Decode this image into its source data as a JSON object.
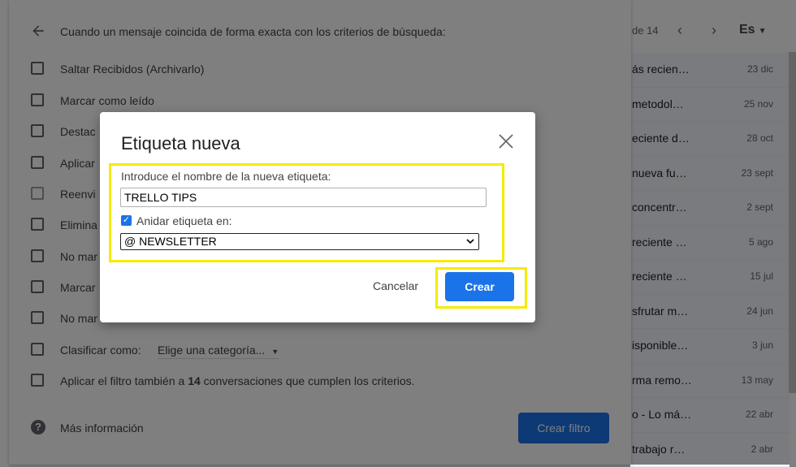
{
  "mail_list": {
    "range_text": "de 14",
    "lang_label": "Es",
    "rows": [
      {
        "snippet": "ás recien…",
        "date": "23 dic"
      },
      {
        "snippet": "metodol…",
        "date": "25 nov"
      },
      {
        "snippet": "eciente d…",
        "date": "28 oct"
      },
      {
        "snippet": "nueva fu…",
        "date": "23 sept"
      },
      {
        "snippet": "concentr…",
        "date": "2 sept"
      },
      {
        "snippet": "reciente …",
        "date": "5 ago"
      },
      {
        "snippet": "reciente …",
        "date": "15 jul"
      },
      {
        "snippet": "sfrutar m…",
        "date": "24 jun"
      },
      {
        "snippet": "isponible…",
        "date": "3 jun"
      },
      {
        "snippet": "rma remo…",
        "date": "13 may"
      },
      {
        "snippet": "o - Lo má…",
        "date": "22 abr"
      },
      {
        "snippet": "trabajo r…",
        "date": "2 abr"
      }
    ]
  },
  "filter": {
    "heading": "Cuando un mensaje coincida de forma exacta con los criterios de búsqueda:",
    "options": [
      "Saltar Recibidos (Archivarlo)",
      "Marcar como leído",
      "Destac",
      "Aplicar",
      "Reenvi",
      "Elimina",
      "No mar",
      "Marcar",
      "No mar"
    ],
    "classify_label": "Clasificar como:",
    "classify_value": "Elige una categoría...",
    "apply_prefix": "Aplicar el filtro también a ",
    "apply_count": "14",
    "apply_suffix": " conversaciones que cumplen los criterios.",
    "more_info": "Más información",
    "create_filter": "Crear filtro"
  },
  "modal": {
    "title": "Etiqueta nueva",
    "name_label": "Introduce el nombre de la nueva etiqueta:",
    "name_value": "TRELLO TIPS",
    "nest_checked": true,
    "nest_label": "Anidar etiqueta en:",
    "parent_value": "@ NEWSLETTER",
    "cancel": "Cancelar",
    "create": "Crear"
  },
  "colors": {
    "accent": "#1a73e8",
    "highlight": "#f5eb00"
  }
}
